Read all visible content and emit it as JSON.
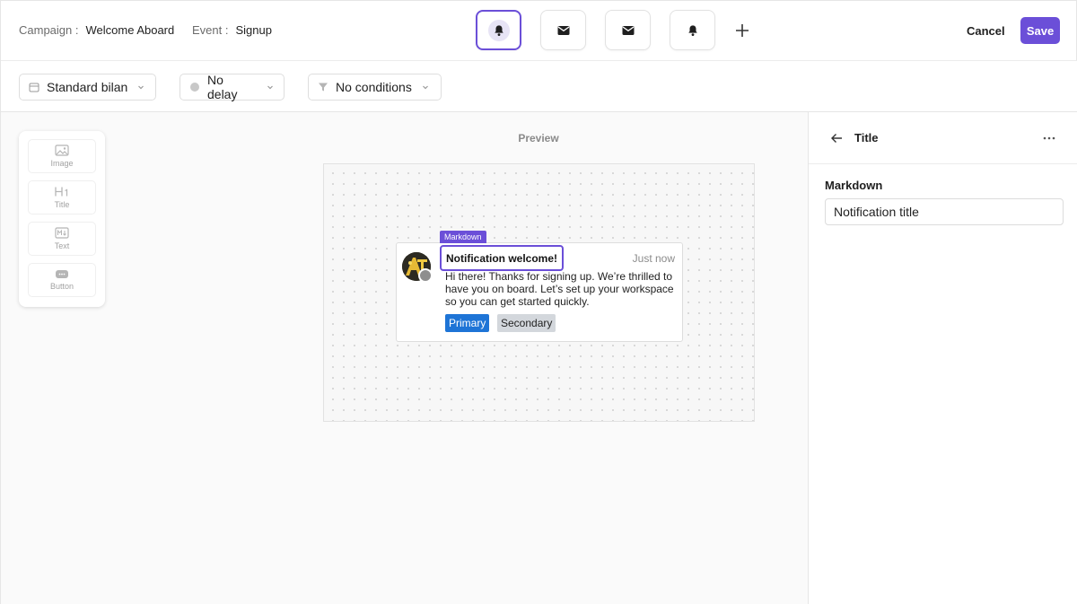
{
  "header": {
    "campaign_key": "Campaign :",
    "campaign_value": "Welcome Aboard",
    "event_key": "Event :",
    "event_value": "Signup",
    "channels": [
      {
        "icon": "bell-icon",
        "active": true
      },
      {
        "icon": "mail-icon",
        "active": false
      },
      {
        "icon": "mail-icon",
        "active": false
      },
      {
        "icon": "bell-icon",
        "active": false
      }
    ],
    "add_icon": "plus-icon",
    "cancel_label": "Cancel",
    "save_label": "Save"
  },
  "filters": {
    "template": {
      "icon": "calendar-icon",
      "label": "Standard bilan"
    },
    "delay": {
      "icon": "clock-icon",
      "label": "No delay"
    },
    "conditions": {
      "icon": "filter-icon",
      "label": "No conditions"
    }
  },
  "toolbox": {
    "items": [
      {
        "icon": "image-icon",
        "label": "Image"
      },
      {
        "icon": "heading-icon",
        "label": "Title"
      },
      {
        "icon": "text-icon",
        "label": "Text"
      },
      {
        "icon": "button-icon",
        "label": "Button"
      }
    ]
  },
  "preview": {
    "label": "Preview",
    "tag": "Markdown",
    "notification": {
      "title": "Notification welcome!",
      "time": "Just now",
      "body": "Hi there! Thanks for signing up. We’re thrilled to have you on board. Let’s set up your workspace so you can get started quickly.",
      "primary_label": "Primary",
      "secondary_label": "Secondary"
    }
  },
  "panel": {
    "title": "Title",
    "field_label": "Markdown",
    "field_value": "Notification title"
  },
  "colors": {
    "accent": "#6b4fd8",
    "primary_button": "#1e74d6",
    "secondary_button": "#d3d7dc"
  }
}
